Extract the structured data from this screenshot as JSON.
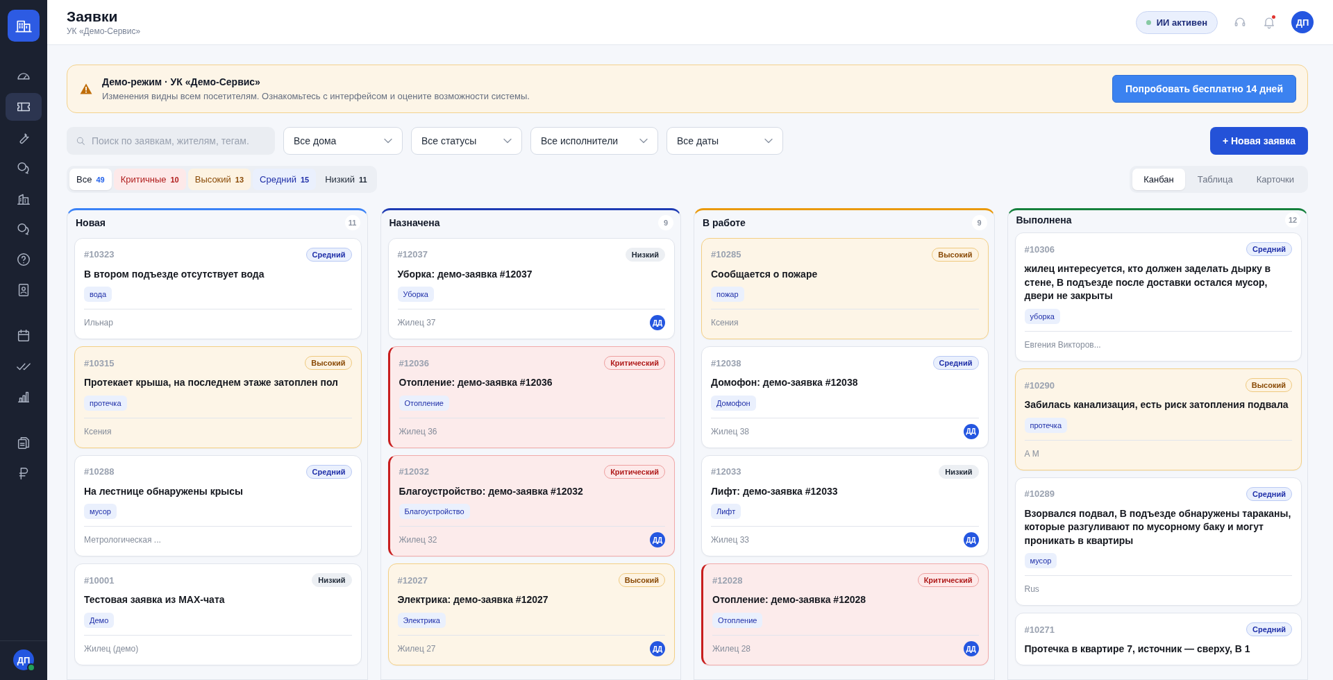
{
  "sidebar": {
    "groups": [
      [
        {
          "selected": false
        },
        {
          "selected": true
        },
        {
          "selected": false
        },
        {
          "selected": false
        },
        {
          "selected": false
        },
        {
          "selected": false
        },
        {
          "selected": false
        },
        {
          "selected": false
        }
      ],
      [
        {
          "selected": false
        },
        {
          "selected": false
        },
        {
          "selected": false
        }
      ],
      [
        {
          "selected": false
        },
        {
          "selected": false
        }
      ]
    ],
    "user": {
      "initials": "ДП",
      "online": true
    }
  },
  "header": {
    "title": "Заявки",
    "subtitle": "УК «Демо-Сервис»",
    "ai_status": {
      "label": "ИИ активен",
      "active": true
    },
    "notifications_unread": true,
    "user_initials": "ДП"
  },
  "banner": {
    "title": "Демо-режим · УК «Демо-Сервис»",
    "text": "Изменения видны всем посетителям. Ознакомьтесь с интерфейсом и оцените возможности системы.",
    "button": "Попробовать бесплатно 14 дней"
  },
  "filters": {
    "search": {
      "placeholder": "Поиск по заявкам, жителям, тегам."
    },
    "selects": [
      "Все дома",
      "Все статусы",
      "Все исполнители",
      "Все даты"
    ],
    "new_button": "+ Новая заявка"
  },
  "priority_tabs": [
    {
      "kind": "all",
      "label": "Все",
      "count": "49",
      "selected": true
    },
    {
      "kind": "critical",
      "label": "Критичные",
      "count": "10",
      "selected": false
    },
    {
      "kind": "high",
      "label": "Высокий",
      "count": "13",
      "selected": false
    },
    {
      "kind": "medium",
      "label": "Средний",
      "count": "15",
      "selected": false
    },
    {
      "kind": "low",
      "label": "Низкий",
      "count": "11",
      "selected": false
    }
  ],
  "view_tabs": [
    {
      "label": "Канбан",
      "selected": true
    },
    {
      "label": "Таблица",
      "selected": false
    },
    {
      "label": "Карточки",
      "selected": false
    }
  ],
  "columns": [
    {
      "name": "Новая",
      "count": "11",
      "color": "#3b82f6",
      "cards": [
        {
          "id": "#10323",
          "kind": "medium",
          "priority": "Средний",
          "title": "В втором подъезде отсутствует вода",
          "tag": "вода",
          "author": "Ильнар"
        },
        {
          "id": "#10315",
          "kind": "high",
          "priority": "Высокий",
          "title": "Протекает крыша, на последнем этаже затоплен пол",
          "tag": "протечка",
          "author": "Ксения"
        },
        {
          "id": "#10288",
          "kind": "medium",
          "priority": "Средний",
          "title": "На лестнице обнаружены крысы",
          "tag": "мусор",
          "author": "Метрологическая ..."
        },
        {
          "id": "#10001",
          "kind": "low",
          "priority": "Низкий",
          "title": "Тестовая заявка из MAX-чата",
          "tag": "Демо",
          "author": "Жилец (демо)"
        }
      ]
    },
    {
      "name": "Назначена",
      "count": "9",
      "color": "#1e3bb3",
      "cards": [
        {
          "id": "#12037",
          "kind": "low",
          "priority": "Низкий",
          "title": "Уборка: демо-заявка #12037",
          "tag": "Уборка",
          "author": "Жилец 37",
          "assignee": "ДД"
        },
        {
          "id": "#12036",
          "kind": "critical",
          "priority": "Критический",
          "title": "Отопление: демо-заявка #12036",
          "tag": "Отопление",
          "author": "Жилец 36"
        },
        {
          "id": "#12032",
          "kind": "critical",
          "priority": "Критический",
          "title": "Благоустройство: демо-заявка #12032",
          "tag": "Благоустройство",
          "author": "Жилец 32",
          "assignee": "ДД"
        },
        {
          "id": "#12027",
          "kind": "high",
          "priority": "Высокий",
          "title": "Электрика: демо-заявка #12027",
          "tag": "Электрика",
          "author": "Жилец 27",
          "assignee": "ДД"
        }
      ]
    },
    {
      "name": "В работе",
      "count": "9",
      "color": "#ea9a0c",
      "cards": [
        {
          "id": "#10285",
          "kind": "high",
          "priority": "Высокий",
          "title": "Сообщается о пожаре",
          "tag": "пожар",
          "author": "Ксения"
        },
        {
          "id": "#12038",
          "kind": "medium",
          "priority": "Средний",
          "title": "Домофон: демо-заявка #12038",
          "tag": "Домофон",
          "author": "Жилец 38",
          "assignee": "ДД"
        },
        {
          "id": "#12033",
          "kind": "low",
          "priority": "Низкий",
          "title": "Лифт: демо-заявка #12033",
          "tag": "Лифт",
          "author": "Жилец 33",
          "assignee": "ДД"
        },
        {
          "id": "#12028",
          "kind": "critical",
          "priority": "Критический",
          "title": "Отопление: демо-заявка #12028",
          "tag": "Отопление",
          "author": "Жилец 28",
          "assignee": "ДД"
        }
      ]
    },
    {
      "name": "Выполнена",
      "count": "12",
      "color": "#15803d",
      "cards": [
        {
          "id": "#10306",
          "kind": "medium",
          "priority": "Средний",
          "title": "жилец интересуется, кто должен заделать дырку в стене, В подъезде после доставки остался мусор, двери не закрыты",
          "tag": "уборка",
          "author": "Евгения Викторов..."
        },
        {
          "id": "#10290",
          "kind": "high",
          "priority": "Высокий",
          "title": "Забилась канализация, есть риск затопления подвала",
          "tag": "протечка",
          "author": "А М"
        },
        {
          "id": "#10289",
          "kind": "medium",
          "priority": "Средний",
          "title": "Взорвался подвал, В подъезде обнаружены тараканы, которые разгуливают по мусорному баку и могут проникать в квартиры",
          "tag": "мусор",
          "author": "Rus"
        },
        {
          "id": "#10271",
          "kind": "medium",
          "priority": "Средний",
          "title": "Протечка в квартире 7, источник — сверху, В 1"
        }
      ]
    }
  ]
}
